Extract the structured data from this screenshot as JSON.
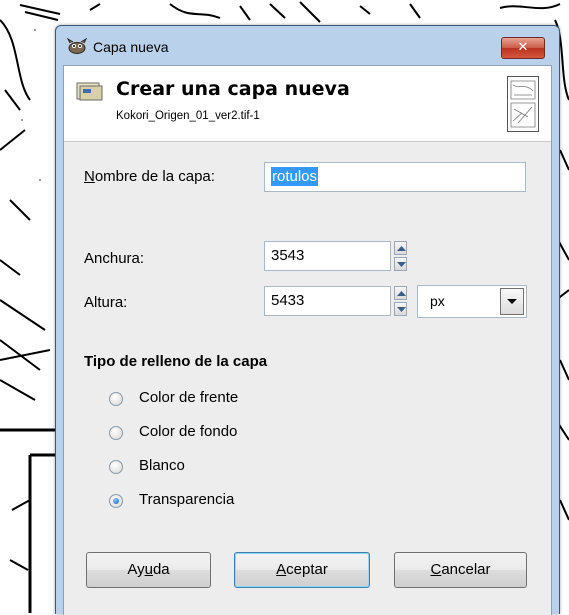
{
  "window": {
    "title": "Capa nueva",
    "close_label": "✕"
  },
  "header": {
    "title": "Crear una capa nueva",
    "subtitle": "Kokori_Origen_01_ver2.tif-1"
  },
  "form": {
    "name_label": {
      "key": "N",
      "rest": "ombre de la capa:"
    },
    "name_value": "rotulos",
    "width_label": "Anchura:",
    "width_value": "3543",
    "height_label": "Altura:",
    "height_value": "5433",
    "unit": "px"
  },
  "fill": {
    "title": "Tipo de relleno de la capa",
    "options": [
      {
        "label": "Color de frente",
        "checked": false
      },
      {
        "label": "Color de fondo",
        "checked": false
      },
      {
        "label": "Blanco",
        "checked": false
      },
      {
        "label": "Transparencia",
        "checked": true
      }
    ]
  },
  "buttons": {
    "help": {
      "pre": "Ay",
      "key": "u",
      "post": "da"
    },
    "ok": {
      "pre": "",
      "key": "A",
      "post": "ceptar"
    },
    "cancel": {
      "pre": "",
      "key": "C",
      "post": "ancelar"
    }
  },
  "colors": {
    "titlebar": "#b9d1ea",
    "selection": "#3399ff",
    "close": "#c75a46"
  },
  "icons": [
    "gimp-mascot-icon",
    "layer-icon",
    "image-thumbnail",
    "spin-up-icon",
    "spin-down-icon",
    "chevron-down-icon"
  ]
}
